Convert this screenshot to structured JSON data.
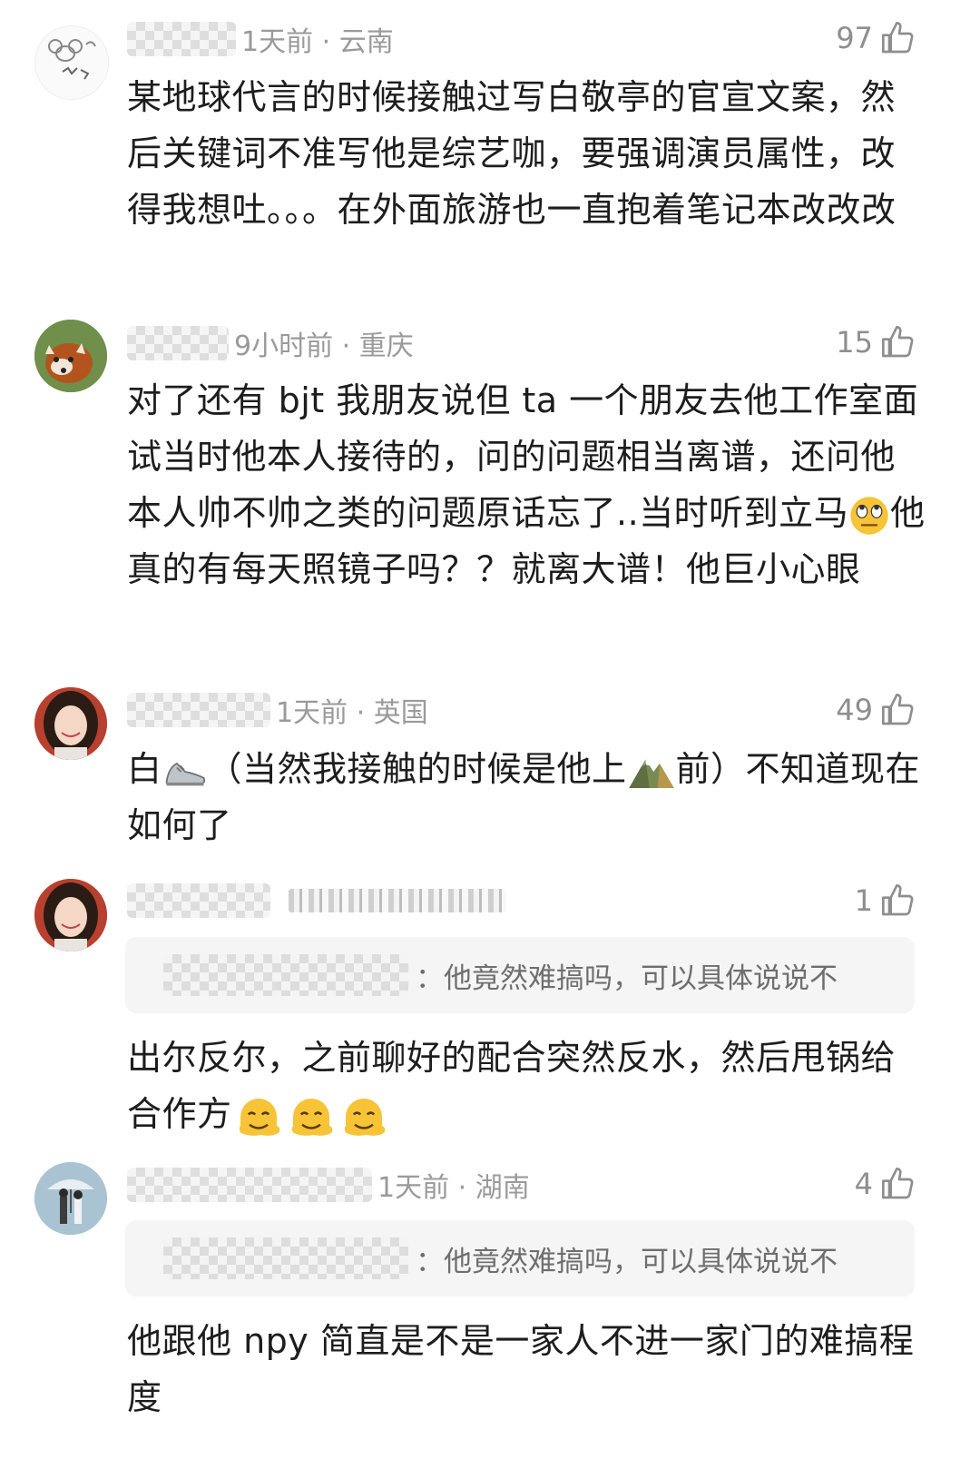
{
  "comments": [
    {
      "time_location": "1天前 · 云南",
      "likes": "97",
      "text": "某地球代言的时候接触过写白敬亭的官宣文案，然后关键词不准写他是综艺咖，要强调演员属性，改得我想吐。。。在外面旅游也一直抱着笔记本改改改"
    },
    {
      "time_location": "9小时前 · 重庆",
      "likes": "15",
      "text_a": "对了还有 bjt 我朋友说但 ta 一个朋友去他工作室面试当时他本人接待的，问的问题相当离谱，还问他本人帅不帅之类的问题原话忘了..当时听到立马",
      "text_b": "他真的有每天照镜子吗？？就离大谱！他巨小心眼"
    },
    {
      "time_location": "1天前 · 英国",
      "likes": "49",
      "text_a": "白",
      "text_b": "（当然我接触的时候是他上",
      "text_c": "前）不知道现在如何了"
    },
    {
      "likes": "1",
      "quote": "：他竟然难搞吗，可以具体说说不",
      "text": "出尔反尔，之前聊好的配合突然反水，然后甩锅给合作方"
    },
    {
      "time_location": "1天前 · 湖南",
      "likes": "4",
      "quote": "：他竟然难搞吗，可以具体说说不",
      "text": "他跟他 npy 简直是不是一家人不进一家门的难搞程度"
    }
  ]
}
